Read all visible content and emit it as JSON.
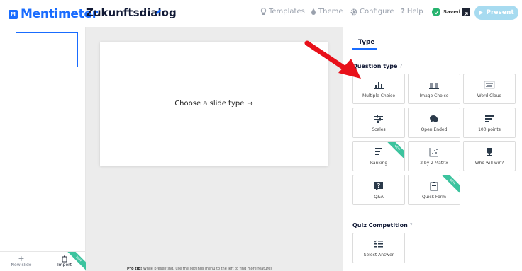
{
  "header": {
    "brand": "Mentimeter",
    "logo_mark": "M",
    "presentation_title": "Zukunftsdialog",
    "nav": [
      {
        "label": "Templates",
        "icon": "lightbulb-icon"
      },
      {
        "label": "Theme",
        "icon": "drop-icon"
      },
      {
        "label": "Configure",
        "icon": "gear-icon"
      },
      {
        "label": "Help",
        "icon": "question-icon"
      }
    ],
    "saved_label": "Saved",
    "present_label": "Present",
    "colors": {
      "brand": "#196cff",
      "saved": "#26b36e",
      "present": "#a7dbf0"
    }
  },
  "slide_list": {
    "new_slide_label": "New slide",
    "import_label": "Import",
    "import_badge": "NEW"
  },
  "canvas": {
    "placeholder": "Choose a slide type",
    "protip_bold": "Pro tip!",
    "protip_text": "While presenting, use the settings menu to the left to find more features"
  },
  "panel": {
    "tab": "Type",
    "question_type_heading": "Question type",
    "help_mark": "?",
    "question_types": [
      {
        "label": "Multiple Choice",
        "icon": "bar-chart-icon",
        "badge": ""
      },
      {
        "label": "Image Choice",
        "icon": "image-bars-icon",
        "badge": ""
      },
      {
        "label": "Word Cloud",
        "icon": "word-cloud-icon",
        "badge": ""
      },
      {
        "label": "Scales",
        "icon": "sliders-icon",
        "badge": ""
      },
      {
        "label": "Open Ended",
        "icon": "speech-bubbles-icon",
        "badge": ""
      },
      {
        "label": "100 points",
        "icon": "stacked-bars-icon",
        "badge": ""
      },
      {
        "label": "Ranking",
        "icon": "ranking-icon",
        "badge": "NEW"
      },
      {
        "label": "2 by 2 Matrix",
        "icon": "matrix-icon",
        "badge": ""
      },
      {
        "label": "Who will win?",
        "icon": "trophy-icon",
        "badge": ""
      },
      {
        "label": "Q&A",
        "icon": "qa-icon",
        "badge": ""
      },
      {
        "label": "Quick Form",
        "icon": "clipboard-icon",
        "badge": "NEW"
      }
    ],
    "quiz_heading": "Quiz Competition",
    "quiz_types": [
      {
        "label": "Select Answer",
        "icon": "checklist-icon"
      }
    ],
    "badge_color": "#3cc39e"
  }
}
